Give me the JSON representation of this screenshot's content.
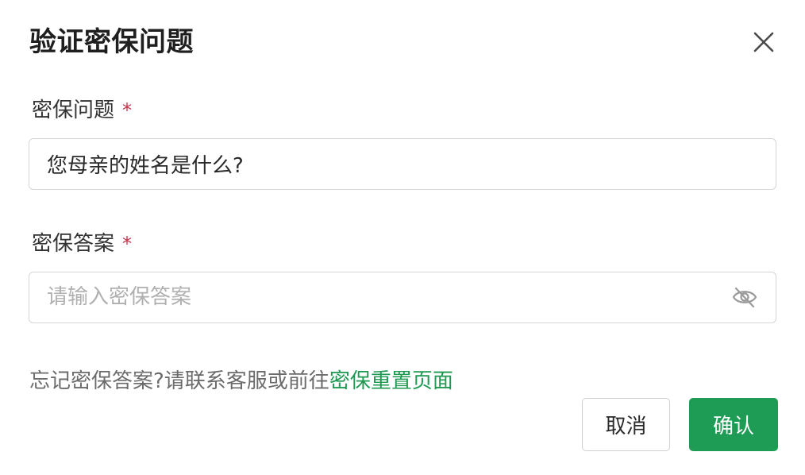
{
  "dialog": {
    "title": "验证密保问题",
    "close_icon": "close-icon"
  },
  "question_field": {
    "label": "密保问题",
    "required_mark": "*",
    "value": "您母亲的姓名是什么?"
  },
  "answer_field": {
    "label": "密保答案",
    "required_mark": "*",
    "value": "",
    "placeholder": "请输入密保答案",
    "toggle_icon": "eye-off-icon"
  },
  "help": {
    "text": "忘记密保答案?请联系客服或前往",
    "link_text": "密保重置页面"
  },
  "footer": {
    "cancel_label": "取消",
    "confirm_label": "确认"
  },
  "colors": {
    "accent": "#1e9b55",
    "link": "#1d9a52",
    "required": "#c8324b"
  }
}
